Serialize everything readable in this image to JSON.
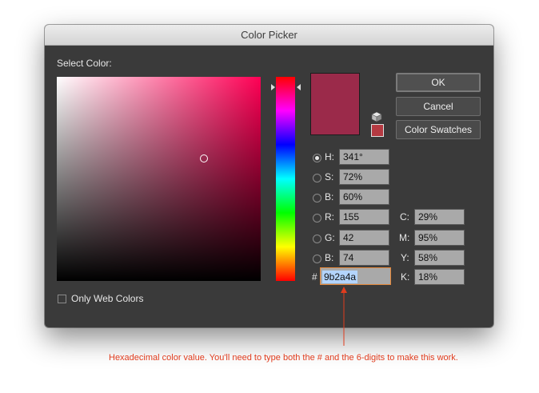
{
  "window": {
    "title": "Color Picker"
  },
  "select_label": "Select Color:",
  "colors": {
    "current": "#9b2a4a",
    "hue_base": "#ff0055",
    "gamut_warning": "#b53a42",
    "annotation": "#e03c1e"
  },
  "selection": {
    "hue_degrees": 341,
    "saturation": 0.72,
    "brightness": 0.6
  },
  "buttons": {
    "ok": "OK",
    "cancel": "Cancel",
    "swatches": "Color Swatches"
  },
  "hsb": [
    {
      "label": "H:",
      "value": "341°",
      "selected": true
    },
    {
      "label": "S:",
      "value": "72%",
      "selected": false
    },
    {
      "label": "B:",
      "value": "60%",
      "selected": false
    }
  ],
  "rgb": [
    {
      "label": "R:",
      "value": "155"
    },
    {
      "label": "G:",
      "value": "42"
    },
    {
      "label": "B:",
      "value": "74"
    }
  ],
  "cmyk": [
    {
      "label": "C:",
      "value": "29%"
    },
    {
      "label": "M:",
      "value": "95%"
    },
    {
      "label": "Y:",
      "value": "58%"
    },
    {
      "label": "K:",
      "value": "18%"
    }
  ],
  "hex": {
    "prefix": "#",
    "value": "9b2a4a"
  },
  "web_colors": {
    "label": "Only Web Colors",
    "checked": false
  },
  "icons": {
    "gamut_alert": "cube-icon",
    "slider_arrows": "triangle-icon"
  },
  "annotation": "Hexadecimal color value. You'll need to type both the # and the 6-digits to make this work."
}
